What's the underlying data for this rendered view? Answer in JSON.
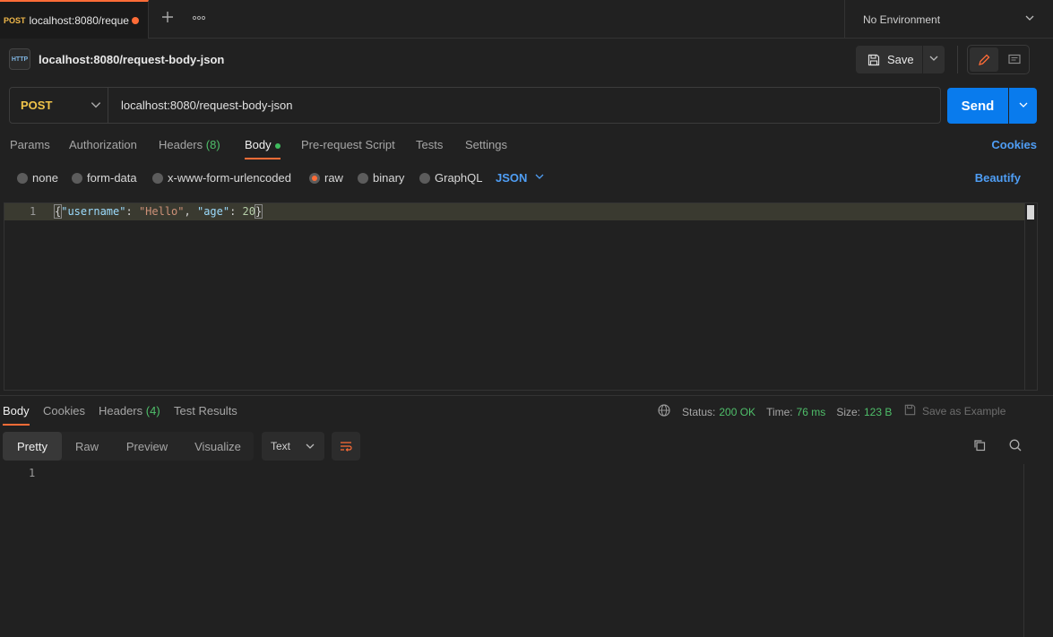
{
  "tab": {
    "method": "POST",
    "title": "localhost:8080/reque"
  },
  "environment": {
    "label": "No Environment"
  },
  "request": {
    "title": "localhost:8080/request-body-json",
    "http_icon_text": "HTTP",
    "save_label": "Save",
    "method": "POST",
    "url": "localhost:8080/request-body-json",
    "send_label": "Send"
  },
  "request_tabs": {
    "params": "Params",
    "authorization": "Authorization",
    "headers": "Headers",
    "headers_count": "(8)",
    "body": "Body",
    "pre_request": "Pre-request Script",
    "tests": "Tests",
    "settings": "Settings",
    "cookies": "Cookies"
  },
  "body_types": {
    "none": "none",
    "form_data": "form-data",
    "urlencoded": "x-www-form-urlencoded",
    "raw": "raw",
    "binary": "binary",
    "graphql": "GraphQL",
    "format": "JSON",
    "beautify": "Beautify",
    "selected": "raw"
  },
  "editor": {
    "line_number": "1",
    "tokens": {
      "open": "{",
      "key1": "\"username\"",
      "sep1": ": ",
      "val1": "\"Hello\"",
      "comma": ", ",
      "key2": "\"age\"",
      "sep2": ": ",
      "val2": "20",
      "close": "}"
    }
  },
  "response_tabs": {
    "body": "Body",
    "cookies": "Cookies",
    "headers": "Headers",
    "headers_count": "(4)",
    "test_results": "Test Results"
  },
  "response_status": {
    "status_label": "Status:",
    "status_value": "200 OK",
    "time_label": "Time:",
    "time_value": "76 ms",
    "size_label": "Size:",
    "size_value": "123 B",
    "save_example": "Save as Example"
  },
  "response_view": {
    "pretty": "Pretty",
    "raw": "Raw",
    "preview": "Preview",
    "visualize": "Visualize",
    "format": "Text",
    "line_number": "1"
  },
  "colors": {
    "accent": "#ff6c37",
    "primary": "#097bed",
    "success": "#4fbf6a",
    "method_post": "#f0c44a"
  },
  "icons": [
    "plus-icon",
    "more-icon",
    "chevron-down-icon",
    "http-icon",
    "save-icon",
    "pencil-icon",
    "comment-icon",
    "globe-icon",
    "wrap-icon",
    "copy-icon",
    "search-icon"
  ]
}
